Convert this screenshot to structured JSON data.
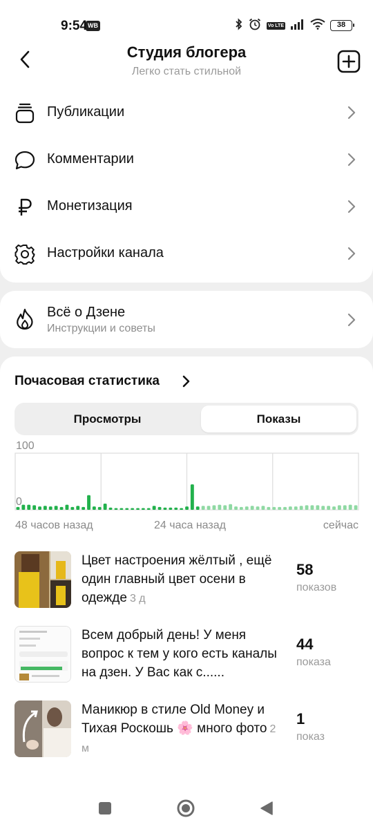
{
  "status": {
    "time": "9:54",
    "badge": "WB",
    "volte": "Vo LTE",
    "battery": "38",
    "icons": [
      "bluetooth-icon",
      "alarm-icon",
      "volte-icon",
      "signal-icon",
      "wifi-icon",
      "battery-icon"
    ]
  },
  "header": {
    "title": "Студия блогера",
    "subtitle": "Легко стать стильной"
  },
  "menu": {
    "items": [
      {
        "label": "Публикации",
        "icon": "publications-icon"
      },
      {
        "label": "Комментарии",
        "icon": "comment-icon"
      },
      {
        "label": "Монетизация",
        "icon": "ruble-icon"
      },
      {
        "label": "Настройки канала",
        "icon": "gear-icon"
      }
    ]
  },
  "zen": {
    "title": "Всё о Дзене",
    "subtitle": "Инструкции и советы"
  },
  "stats": {
    "title": "Почасовая статистика",
    "tabs": [
      "Просмотры",
      "Показы"
    ],
    "active_tab": "Показы"
  },
  "chart_data": {
    "type": "bar",
    "y_ticks": [
      "100",
      "0"
    ],
    "ylim": [
      0,
      100
    ],
    "x_labels": [
      "48 часов назад",
      "24 часа назад",
      "сейчас"
    ],
    "grid": true,
    "colors": {
      "past": "#22b14c",
      "recent": "#8fd9a3"
    },
    "recent_from_index": 34,
    "values": [
      5,
      9,
      9,
      8,
      6,
      7,
      6,
      7,
      5,
      9,
      5,
      7,
      5,
      26,
      6,
      5,
      11,
      4,
      3,
      3,
      3,
      3,
      3,
      3,
      3,
      7,
      5,
      4,
      4,
      4,
      3,
      6,
      45,
      6,
      7,
      7,
      8,
      9,
      8,
      10,
      6,
      5,
      6,
      7,
      6,
      7,
      5,
      5,
      5,
      5,
      6,
      6,
      7,
      8,
      8,
      8,
      7,
      7,
      6,
      8,
      8,
      9,
      8
    ]
  },
  "feed": [
    {
      "text": "Цвет настроения жёлтый , ещё один главный цвет осени в одежде",
      "age": "3 д",
      "count": "58",
      "unit": "показов"
    },
    {
      "text": "Всем добрый день! У меня вопрос к тем у кого есть каналы на дзен. У Вас как с......",
      "age": "",
      "count": "44",
      "unit": "показа"
    },
    {
      "text": "Маникюр в стиле Old Money и Тихая Роскошь 🌸 много фото",
      "age": "2 м",
      "count": "1",
      "unit": "показ"
    }
  ],
  "navbar": {
    "icons": [
      "recent-apps-icon",
      "home-icon",
      "back-nav-icon"
    ]
  }
}
